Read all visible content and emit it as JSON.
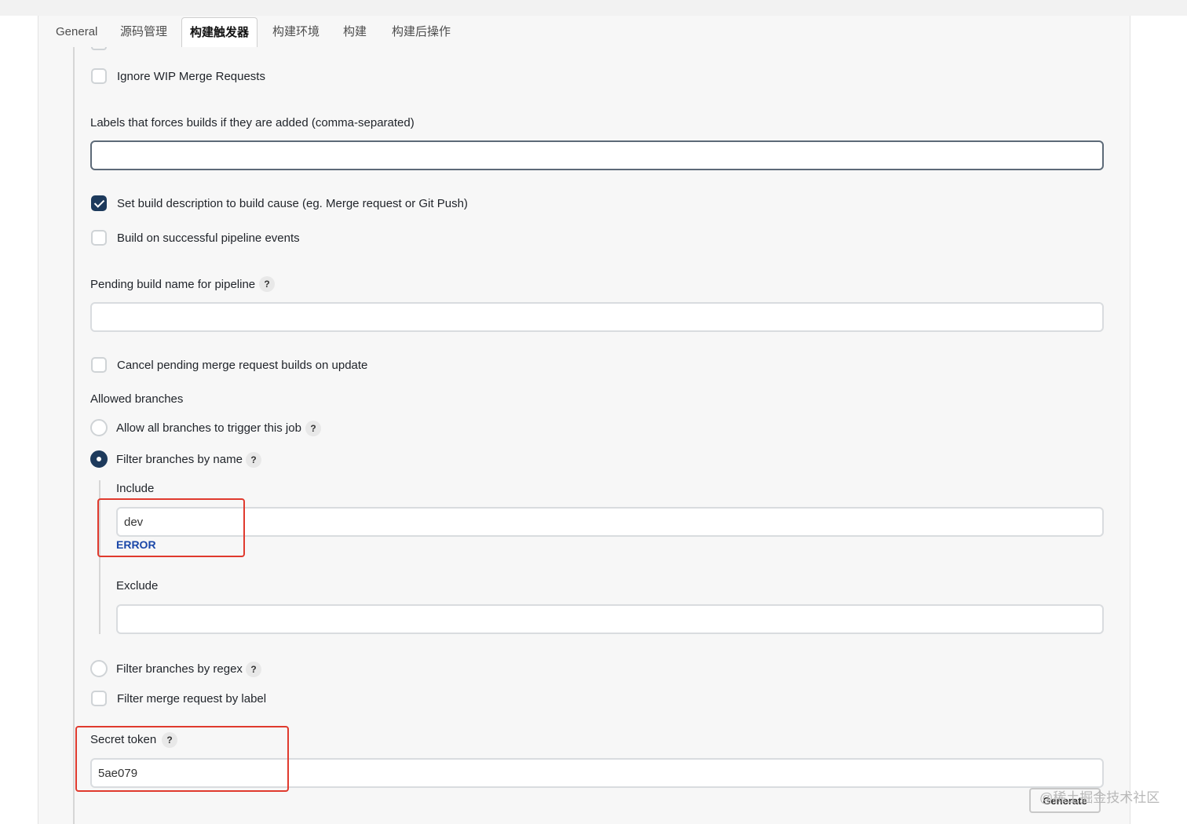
{
  "tabs": [
    {
      "label": "General",
      "active": false
    },
    {
      "label": "源码管理",
      "active": false
    },
    {
      "label": "构建触发器",
      "active": true
    },
    {
      "label": "构建环境",
      "active": false
    },
    {
      "label": "构建",
      "active": false
    },
    {
      "label": "构建后操作",
      "active": false
    }
  ],
  "form": {
    "ignore_wip": {
      "label": "Ignore WIP Merge Requests",
      "checked": false
    },
    "labels_force": {
      "label": "Labels that forces builds if they are added (comma-separated)",
      "value": ""
    },
    "set_build_desc": {
      "label": "Set build description to build cause (eg. Merge request or Git Push)",
      "checked": true
    },
    "build_on_pipeline": {
      "label": "Build on successful pipeline events",
      "checked": false
    },
    "pending_build_name": {
      "label": "Pending build name for pipeline",
      "value": ""
    },
    "cancel_pending": {
      "label": "Cancel pending merge request builds on update",
      "checked": false
    },
    "allowed_branches": {
      "title": "Allowed branches",
      "options": [
        {
          "label": "Allow all branches to trigger this job",
          "selected": false
        },
        {
          "label": "Filter branches by name",
          "selected": true
        },
        {
          "label": "Filter branches by regex",
          "selected": false
        }
      ],
      "include": {
        "label": "Include",
        "value": "dev",
        "error": "ERROR"
      },
      "exclude": {
        "label": "Exclude",
        "value": ""
      }
    },
    "filter_by_label": {
      "label": "Filter merge request by label",
      "checked": false
    },
    "secret_token": {
      "label": "Secret token",
      "value": "5ae079                     "
    },
    "generate_label": "Generate"
  },
  "help_glyph": "?",
  "watermark": "@稀土掘金技术社区",
  "colors": {
    "accent": "#1d3a5c",
    "error_text": "#1a47a8",
    "highlight": "#e03a2e"
  }
}
